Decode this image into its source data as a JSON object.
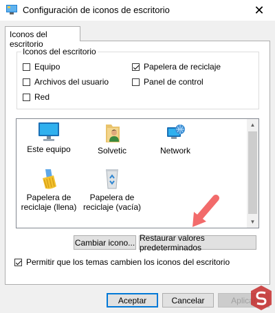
{
  "window": {
    "title": "Configuración de iconos de escritorio",
    "close_glyph": "✕"
  },
  "tab": {
    "label": "Iconos del escritorio"
  },
  "group": {
    "legend": "Iconos del escritorio",
    "checkboxes": [
      {
        "label": "Equipo",
        "checked": false
      },
      {
        "label": "Archivos del usuario",
        "checked": false
      },
      {
        "label": "Red",
        "checked": false
      },
      {
        "label": "Papelera de reciclaje",
        "checked": true
      },
      {
        "label": "Panel de control",
        "checked": false
      }
    ]
  },
  "icons": [
    {
      "label": "Este equipo",
      "icon": "monitor-icon"
    },
    {
      "label": "Solvetic",
      "icon": "user-folder-icon"
    },
    {
      "label": "Network",
      "icon": "network-globe-icon"
    },
    {
      "label": "Papelera de reciclaje (llena)",
      "line1": "Papelera de",
      "line2": "reciclaje (llena)",
      "icon": "recycle-bin-full-icon"
    },
    {
      "label": "Papelera de reciclaje (vacía)",
      "line1": "Papelera de",
      "line2": "reciclaje (vacía)",
      "icon": "recycle-bin-empty-icon"
    }
  ],
  "buttons": {
    "change_icon": "Cambiar icono...",
    "restore_defaults": "Restaurar valores predeterminados",
    "ok": "Aceptar",
    "cancel": "Cancelar",
    "apply": "Aplicar"
  },
  "allow_themes": {
    "label": "Permitir que los temas cambien los iconos del escritorio",
    "checked": true
  },
  "colors": {
    "accent": "#0078d7",
    "arrow": "#f26b6b"
  }
}
